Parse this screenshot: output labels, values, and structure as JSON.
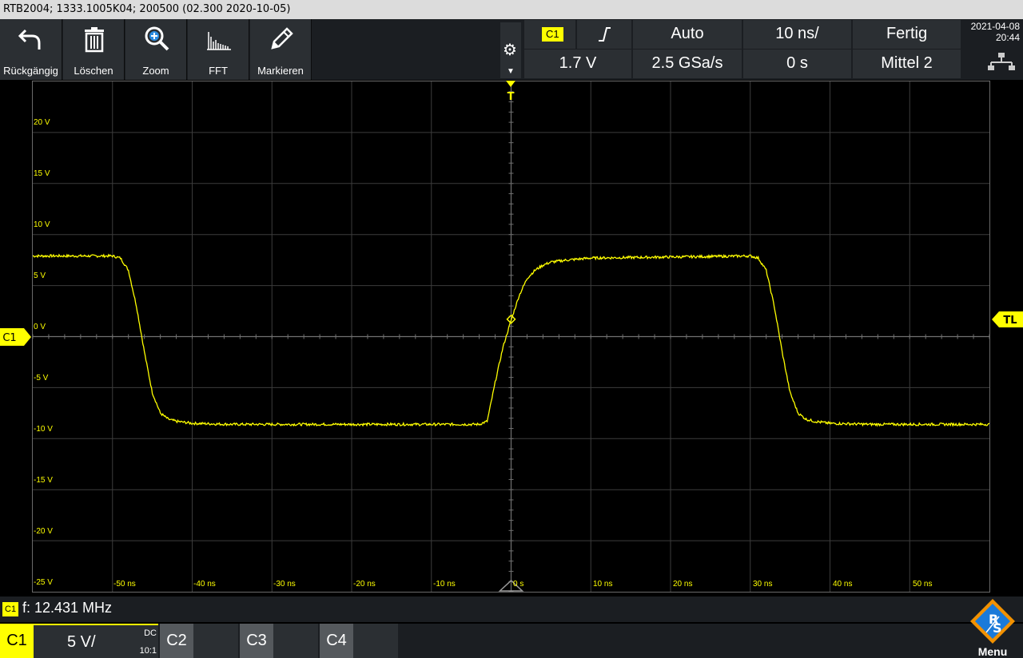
{
  "title": "RTB2004; 1333.1005K04; 200500 (02.300 2020-10-05)",
  "toolbar": {
    "undo": "Rückgängig",
    "delete": "Löschen",
    "zoom": "Zoom",
    "fft": "FFT",
    "mark": "Markieren"
  },
  "params": {
    "channel": "C1",
    "trigger_level": "1.7 V",
    "mode": "Auto",
    "sample_rate": "2.5 GSa/s",
    "timebase": "10 ns/",
    "position": "0 s",
    "state": "Fertig",
    "acq_mode": "Mittel 2"
  },
  "datetime": {
    "date": "2021-04-08",
    "time": "20:44"
  },
  "plot": {
    "y_labels": [
      "20 V",
      "15 V",
      "10 V",
      "5 V",
      "0 V",
      "-5 V",
      "-10 V",
      "-15 V",
      "-20 V",
      "-25 V"
    ],
    "x_labels": [
      "-50 ns",
      "-40 ns",
      "-30 ns",
      "-20 ns",
      "-10 ns",
      "0 s",
      "10 ns",
      "20 ns",
      "30 ns",
      "40 ns",
      "50 ns"
    ],
    "c1_marker": "C1",
    "tl_marker": "TL",
    "trigger_marker": "T"
  },
  "measurement": {
    "channel": "C1",
    "text": "f: 12.431 MHz"
  },
  "channels": {
    "c1": {
      "label": "C1",
      "scale": "5 V/",
      "coupling": "DC",
      "probe": "10:1"
    },
    "c2": "C2",
    "c3": "C3",
    "c4": "C4"
  },
  "menu": "Menu",
  "colors": {
    "trace": "#ffff00",
    "grid": "#3c3c3c",
    "panel": "#2b2f33"
  },
  "chart_data": {
    "type": "line",
    "xlabel": "",
    "ylabel": "",
    "xlim": [
      -60,
      60
    ],
    "ylim": [
      -25,
      25
    ],
    "x": [
      -60,
      -50,
      -49,
      -48,
      -47,
      -46,
      -45,
      -44,
      -43,
      -42,
      -41,
      -40,
      -35,
      -30,
      -20,
      -10,
      -4,
      -3,
      -2,
      -1,
      0,
      1,
      2,
      3,
      4,
      5,
      7,
      10,
      20,
      30,
      31,
      32,
      33,
      34,
      35,
      36,
      37,
      38,
      39,
      40,
      45,
      50,
      60
    ],
    "series": [
      {
        "values": [
          7.9,
          7.9,
          7.7,
          6.5,
          3.0,
          -1.5,
          -5.5,
          -7.5,
          -8.1,
          -8.3,
          -8.4,
          -8.5,
          -8.6,
          -8.6,
          -8.6,
          -8.6,
          -8.6,
          -8.3,
          -4.5,
          -1.0,
          1.6,
          4.0,
          5.7,
          6.5,
          7.0,
          7.3,
          7.5,
          7.7,
          7.8,
          7.9,
          7.7,
          6.5,
          3.0,
          -1.5,
          -5.5,
          -7.5,
          -8.1,
          -8.3,
          -8.4,
          -8.5,
          -8.6,
          -8.6,
          -8.6
        ]
      }
    ]
  }
}
